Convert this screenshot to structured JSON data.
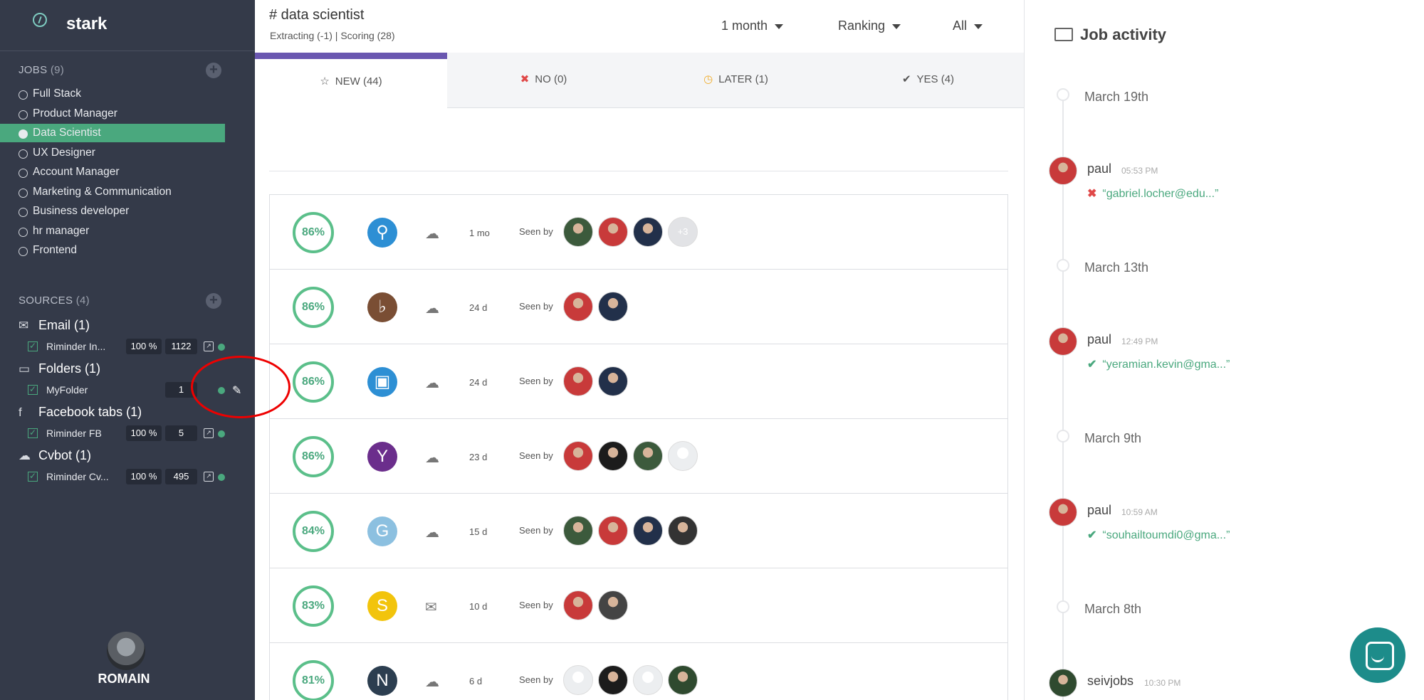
{
  "app": {
    "name": "stark"
  },
  "colors": {
    "sidebar_bg": "#343a49",
    "accent_green": "#4aa87e",
    "tab_accent": "#6a57b0",
    "chat": "#1d8c8a"
  },
  "sidebar": {
    "jobs_header": "JOBS",
    "jobs_count": "(9)",
    "jobs": [
      {
        "label": "Full Stack"
      },
      {
        "label": "Product Manager"
      },
      {
        "label": "Data Scientist",
        "active": true
      },
      {
        "label": "UX Designer"
      },
      {
        "label": "Account Manager"
      },
      {
        "label": "Marketing & Communication"
      },
      {
        "label": "Business developer"
      },
      {
        "label": "hr manager"
      },
      {
        "label": "Frontend"
      }
    ],
    "sources_header": "SOURCES",
    "sources_count": "(4)",
    "sources": [
      {
        "title": "Email (1)",
        "icon": "envelope-icon",
        "row": {
          "name": "Riminder In...",
          "pct": "100 %",
          "count": "1122"
        }
      },
      {
        "title": "Folders (1)",
        "icon": "folder-icon",
        "row": {
          "name": "MyFolder",
          "pct": "",
          "count": "1"
        }
      },
      {
        "title": "Facebook tabs (1)",
        "icon": "facebook-icon",
        "row": {
          "name": "Riminder FB",
          "pct": "100 %",
          "count": "5"
        }
      },
      {
        "title": "Cvbot (1)",
        "icon": "cloud-icon",
        "row": {
          "name": "Riminder Cv...",
          "pct": "100 %",
          "count": "495"
        }
      }
    ],
    "user_name": "ROMAIN"
  },
  "header": {
    "title": "# data scientist",
    "subtitle": "Extracting (-1)  |  Scoring (28)",
    "filters": [
      "1 month",
      "Ranking",
      "All"
    ]
  },
  "tabs": [
    {
      "label": "NEW (44)",
      "icon": "star-icon",
      "glyph": "☆",
      "color": "#555"
    },
    {
      "label": "NO (0)",
      "icon": "cross-icon",
      "glyph": "✖",
      "color": "#e04848"
    },
    {
      "label": "LATER (1)",
      "icon": "clock-icon",
      "glyph": "◷",
      "color": "#f0ad2c"
    },
    {
      "label": "YES (4)",
      "icon": "check-icon",
      "glyph": "✔",
      "color": "#555"
    }
  ],
  "seen_by_label": "Seen by",
  "candidates": [
    {
      "score": "86%",
      "orb_color": "#2d8fd4",
      "orb_text": "⚲",
      "source": "cloud-upload-icon",
      "age": "1 mo",
      "viewers": [
        "#3c5a3c",
        "#c83a3a",
        "#22304a",
        "+3"
      ]
    },
    {
      "score": "86%",
      "orb_color": "#7a4e34",
      "orb_text": "♭",
      "source": "cloud-upload-icon",
      "age": "24 d",
      "viewers": [
        "#c83a3a",
        "#22304a"
      ]
    },
    {
      "score": "86%",
      "orb_color": "#2d8fd4",
      "orb_text": "▣",
      "source": "cloud-upload-icon",
      "age": "24 d",
      "viewers": [
        "#c83a3a",
        "#22304a"
      ]
    },
    {
      "score": "86%",
      "orb_color": "#6b2e8c",
      "orb_text": "Y",
      "source": "cloud-upload-icon",
      "age": "23 d",
      "viewers": [
        "#c83a3a",
        "#1c1c1c",
        "#3c5a3c",
        "ghost"
      ]
    },
    {
      "score": "84%",
      "orb_color": "#8cc0e0",
      "orb_text": "G",
      "source": "cloud-upload-icon",
      "age": "15 d",
      "viewers": [
        "#3c5a3c",
        "#c83a3a",
        "#22304a",
        "#333333"
      ]
    },
    {
      "score": "83%",
      "orb_color": "#f2c40c",
      "orb_text": "S",
      "source": "envelope-icon",
      "age": "10 d",
      "viewers": [
        "#c83a3a",
        "#444444"
      ]
    },
    {
      "score": "81%",
      "orb_color": "#2c3e50",
      "orb_text": "N",
      "source": "cloud-upload-icon",
      "age": "6 d",
      "viewers": [
        "ghost",
        "#1c1c1c",
        "ghost",
        "#2f4a2f"
      ]
    }
  ],
  "activity": {
    "title": "Job activity",
    "entries": [
      {
        "date": "March 19th",
        "user": "paul",
        "time": "05:53 PM",
        "status": "no",
        "msg": "“gabriel.locher@edu...”"
      },
      {
        "date": "March 13th",
        "user": "paul",
        "time": "12:49 PM",
        "status": "yes",
        "msg": "“yeramian.kevin@gma...”"
      },
      {
        "date": "March 9th",
        "user": "paul",
        "time": "10:59 AM",
        "status": "yes",
        "msg": "“souhailtoumdi0@gma...”"
      },
      {
        "date": "March 8th",
        "user": "seivjobs",
        "time": "10:30 PM",
        "status": "",
        "msg": ""
      }
    ]
  }
}
